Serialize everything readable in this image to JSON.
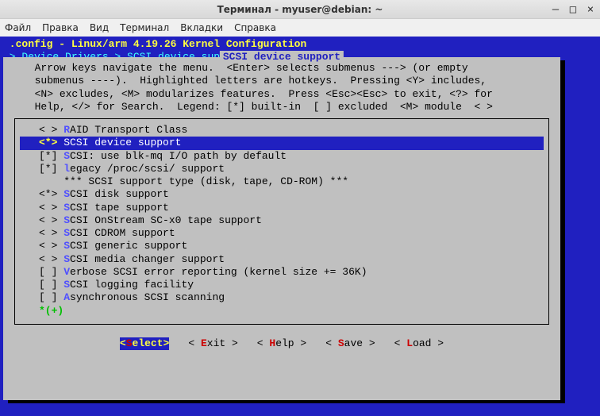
{
  "window": {
    "title": "Терминал - myuser@debian: ~"
  },
  "window_controls": {
    "minimize": "—",
    "maximize": "□",
    "close": "×"
  },
  "menubar": {
    "file": "Файл",
    "edit": "Правка",
    "view": "Вид",
    "terminal": "Терминал",
    "tabs": "Вкладки",
    "help": "Справка"
  },
  "header": {
    "line1": " .config - Linux/arm 4.19.26 Kernel Configuration",
    "line2": " > Device Drivers > SCSI device support"
  },
  "dialog": {
    "title": " SCSI device support ",
    "help": "  Arrow keys navigate the menu.  <Enter> selects submenus ---> (or empty\n  submenus ----).  Highlighted letters are hotkeys.  Pressing <Y> includes,\n  <N> excludes, <M> modularizes features.  Press <Esc><Esc> to exit, <?> for\n  Help, </> for Search.  Legend: [*] built-in  [ ] excluded  <M> module  < >"
  },
  "options": [
    {
      "sym": "< >",
      "hot": "R",
      "rest": "AID Transport Class",
      "sel": false
    },
    {
      "sym": "<*>",
      "hot": "S",
      "rest": "CSI device support",
      "sel": true
    },
    {
      "sym": "[*]",
      "hot": "S",
      "rest": "CSI: use blk-mq I/O path by default",
      "sel": false
    },
    {
      "sym": "[*]",
      "hot": "l",
      "rest": "egacy /proc/scsi/ support",
      "sel": false
    },
    {
      "sym": "   ",
      "hot": "",
      "rest": "*** SCSI support type (disk, tape, CD-ROM) ***",
      "sel": false
    },
    {
      "sym": "<*>",
      "hot": "S",
      "rest": "CSI disk support",
      "sel": false
    },
    {
      "sym": "< >",
      "hot": "S",
      "rest": "CSI tape support",
      "sel": false
    },
    {
      "sym": "< >",
      "hot": "S",
      "rest": "CSI OnStream SC-x0 tape support",
      "sel": false
    },
    {
      "sym": "< >",
      "hot": "S",
      "rest": "CSI CDROM support",
      "sel": false
    },
    {
      "sym": "< >",
      "hot": "S",
      "rest": "CSI generic support",
      "sel": false
    },
    {
      "sym": "< >",
      "hot": "S",
      "rest": "CSI media changer support",
      "sel": false
    },
    {
      "sym": "[ ]",
      "hot": "V",
      "rest": "erbose SCSI error reporting (kernel size += 36K)",
      "sel": false
    },
    {
      "sym": "[ ]",
      "hot": "S",
      "rest": "CSI logging facility",
      "sel": false
    },
    {
      "sym": "[ ]",
      "hot": "A",
      "rest": "synchronous SCSI scanning",
      "sel": false
    }
  ],
  "more": "*(+)",
  "buttons": {
    "select": {
      "pre": "<",
      "hot": "S",
      "rest": "elect>"
    },
    "exit": {
      "pre": "< ",
      "hot": "E",
      "rest": "xit >"
    },
    "help": {
      "pre": "< ",
      "hot": "H",
      "rest": "elp >"
    },
    "save": {
      "pre": "< ",
      "hot": "S",
      "rest": "ave >"
    },
    "load": {
      "pre": "< ",
      "hot": "L",
      "rest": "oad >"
    }
  }
}
